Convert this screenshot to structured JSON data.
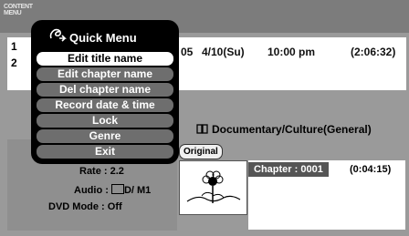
{
  "header": {
    "logo_line1": "CONTENT",
    "logo_line2": "MENU"
  },
  "program_row": {
    "index_1": "1",
    "index_2": "2",
    "channel_suffix": "05",
    "date": "4/10(Su)",
    "time": "10:00 pm",
    "duration": "(2:06:32)"
  },
  "genre": {
    "text": "Documentary/Culture(General)"
  },
  "badges": {
    "original": "Original"
  },
  "info": {
    "rate": "Rate : 2.2",
    "audio_prefix": "Audio : ",
    "audio_suffix": "D/ M1",
    "dvd_mode": "DVD Mode : Off"
  },
  "chapter": {
    "label": "Chapter : 0001",
    "time": "(0:04:15)"
  },
  "quick_menu": {
    "title": "Quick Menu",
    "items": [
      "Edit title name",
      "Edit chapter name",
      "Del chapter name",
      "Record date & time",
      "Lock",
      "Genre",
      "Exit"
    ],
    "selected_index": 0
  },
  "colors": {
    "background": "#9a9a9a",
    "menu_bg": "#000000",
    "menu_item": "#6e6e6e",
    "menu_selected": "#ffffff"
  }
}
